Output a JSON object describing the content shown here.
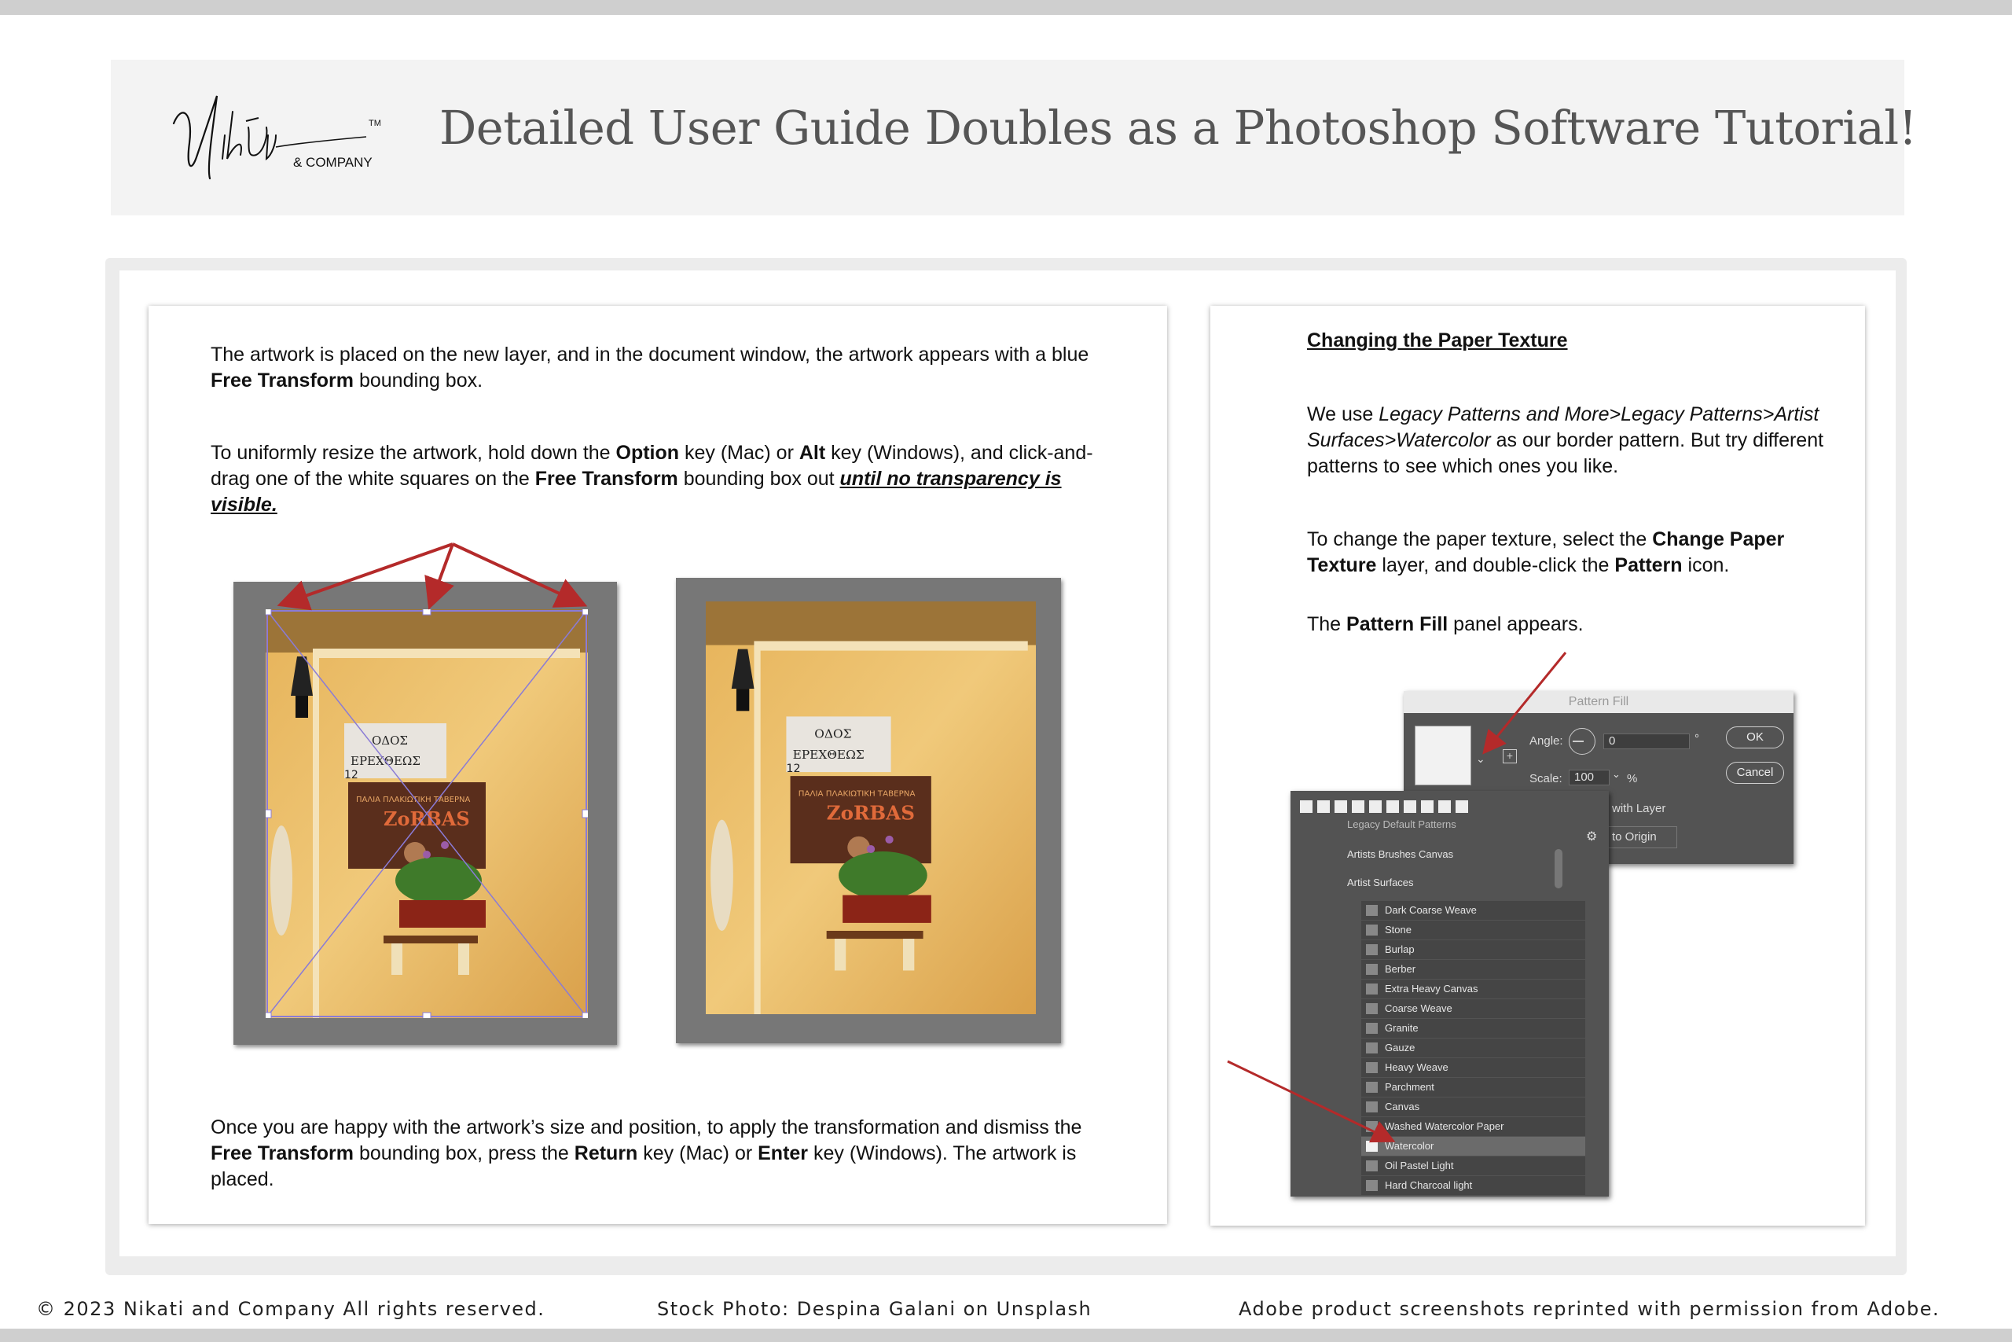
{
  "header": {
    "brand": "Nikāti",
    "brand_tm": "TM",
    "brand_sub": "& COMPANY",
    "title": "Detailed User Guide Doubles as a Photoshop Software Tutorial!"
  },
  "left_page": {
    "p1_a": "The artwork is placed on the new layer, and in the document window, the artwork appears with a blue",
    "p1_b_bold": "Free Transform",
    "p1_b": " bounding box.",
    "p2_a": "To uniformly resize the artwork, hold down the ",
    "p2_option": "Option",
    "p2_b": " key (Mac) or ",
    "p2_alt": "Alt",
    "p2_c": " key (Windows), and click-and-",
    "p2_d": "drag one of the white squares on the ",
    "p2_ft": "Free Transform",
    "p2_e": " bounding box out ",
    "p2_f_em": "until no transparency is",
    "p2_g_em": "visible.",
    "p3_a": "Once you are happy with the artwork’s size and position, to apply the transformation and dismiss the",
    "p3_ft": "Free Transform",
    "p3_b": " bounding box, press the ",
    "p3_return": "Return",
    "p3_c": " key (Mac) or ",
    "p3_enter": "Enter",
    "p3_d": " key (Windows). The artwork is",
    "p3_e": "placed.",
    "photo_sign_1": "ΟΔΟΣ",
    "photo_sign_2": "ΕΡΕΧΘΕΩΣ",
    "photo_sign_num": "12",
    "photo_sign_3": "ΠΑΛΙΑ ΠΛΑΚΙΩΤΙΚΗ ΤΑΒΕΡΝΑ",
    "photo_sign_4": "ZoRBAS"
  },
  "right_page": {
    "heading": "Changing the Paper Texture",
    "p1_a": "We use ",
    "p1_em": "Legacy Patterns and More>Legacy Patterns>Artist",
    "p1_em2": "Surfaces>Watercolor",
    "p1_b": " as our border pattern. But try different",
    "p1_c": "patterns to see which ones you like.",
    "p2_a": "To change the paper texture, select the ",
    "p2_b1": "Change Paper",
    "p2_b2": "Texture",
    "p2_c": " layer, and double-click the ",
    "p2_pattern": "Pattern",
    "p2_d": " icon.",
    "p3_a": "The ",
    "p3_b": "Pattern Fill",
    "p3_c": " panel appears."
  },
  "ps_dialog": {
    "title": "Pattern Fill",
    "angle_label": "Angle:",
    "angle_value": "0",
    "degree": "°",
    "scale_label": "Scale:",
    "scale_value": "100",
    "percent": "%",
    "ok": "OK",
    "cancel": "Cancel",
    "link_text": "with Layer",
    "snap_text": "to Origin"
  },
  "ps_panel": {
    "folder_top": "Legacy Default Patterns",
    "folder_1": "Artists Brushes Canvas",
    "folder_2": "Artist Surfaces",
    "items": [
      "Dark Coarse Weave",
      "Stone",
      "Burlap",
      "Berber",
      "Extra Heavy Canvas",
      "Coarse Weave",
      "Granite",
      "Gauze",
      "Heavy Weave",
      "Parchment",
      "Canvas",
      "Washed Watercolor Paper",
      "Watercolor",
      "Oil Pastel Light",
      "Hard Charcoal light"
    ],
    "selected": "Watercolor"
  },
  "footer": {
    "copyright": "© 2023 Nikati and Company All rights reserved.",
    "stock": "Stock Photo: Despina Galani on Unsplash",
    "adobe": "Adobe product screenshots reprinted with permission from Adobe."
  },
  "colors": {
    "arrow": "#b42a2a",
    "header_bg": "#f3f3f3",
    "frame_bg": "#ececec",
    "ps_bg": "#535353"
  }
}
